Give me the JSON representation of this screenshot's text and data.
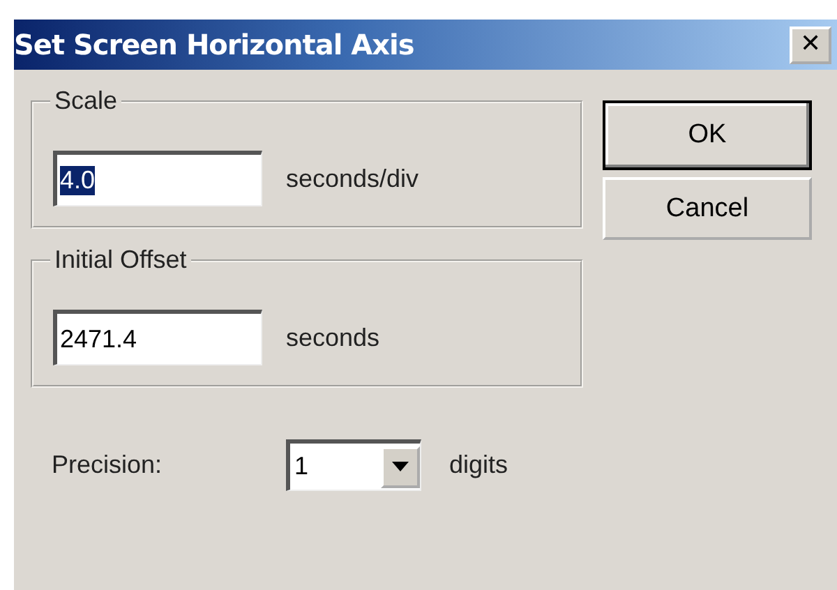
{
  "window": {
    "title": "Set Screen Horizontal Axis",
    "close": "✕"
  },
  "groups": [
    {
      "label": "Scale",
      "value": "4.0",
      "value_selected": true,
      "unit": "seconds/div"
    },
    {
      "label": "Initial Offset",
      "value": "2471.4",
      "value_selected": false,
      "unit": "seconds"
    }
  ],
  "precision": {
    "label": "Precision:",
    "value": "1",
    "unit": "digits"
  },
  "buttons": [
    "OK",
    "Cancel"
  ]
}
